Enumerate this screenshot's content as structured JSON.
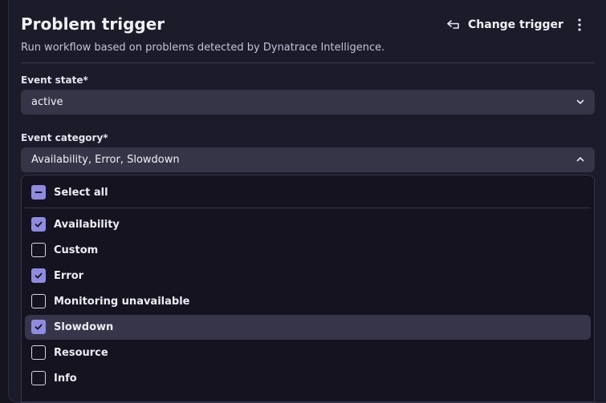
{
  "header": {
    "title": "Problem trigger",
    "change_trigger_label": "Change trigger",
    "subtitle": "Run workflow based on problems detected by Dynatrace Intelligence."
  },
  "event_state": {
    "label": "Event state*",
    "value": "active"
  },
  "event_category": {
    "label": "Event category*",
    "value": "Availability, Error, Slowdown",
    "dropdown_open": true,
    "select_all_label": "Select all",
    "select_all_state": "indeterminate",
    "options": [
      {
        "label": "Availability",
        "checked": true
      },
      {
        "label": "Custom",
        "checked": false
      },
      {
        "label": "Error",
        "checked": true
      },
      {
        "label": "Monitoring unavailable",
        "checked": false
      },
      {
        "label": "Slowdown",
        "checked": true,
        "highlighted": true
      },
      {
        "label": "Resource",
        "checked": false
      },
      {
        "label": "Info",
        "checked": false
      }
    ]
  },
  "icons": {
    "change_trigger": "swap-arrow-icon",
    "more": "kebab-menu-icon",
    "chevron_closed": "chevron-down-icon",
    "chevron_open": "chevron-up-icon",
    "check": "checkmark-icon",
    "indeterminate": "minus-icon"
  },
  "colors": {
    "background": "#1c1b2a",
    "dropdown_bg": "#14131f",
    "select_bg": "#363548",
    "accent": "#8f8be0",
    "highlight": "#36354a"
  }
}
